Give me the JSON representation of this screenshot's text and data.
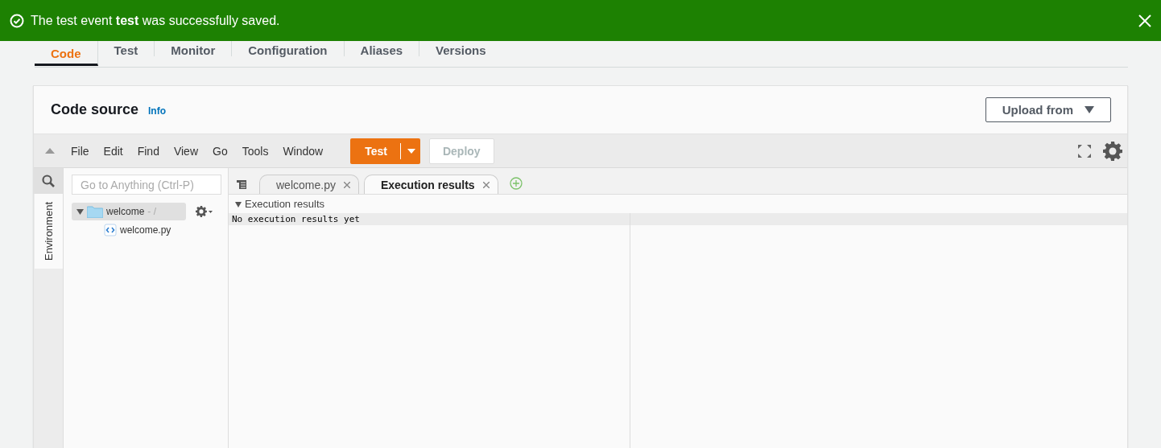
{
  "banner": {
    "kind": "success",
    "message": "The test event **test** was successfully saved."
  },
  "tabs": [
    {
      "label": "Code",
      "selected": true
    },
    {
      "label": "Test",
      "selected": false
    },
    {
      "label": "Monitor",
      "selected": false
    },
    {
      "label": "Configuration",
      "selected": false
    },
    {
      "label": "Aliases",
      "selected": false
    },
    {
      "label": "Versions",
      "selected": false
    }
  ],
  "code_source": {
    "title": "Code source",
    "info_link": "Info",
    "upload_button": "Upload from"
  },
  "toolbar": {
    "menu": [
      "File",
      "Edit",
      "Find",
      "View",
      "Go",
      "Tools",
      "Window"
    ],
    "test_button": "Test",
    "deploy_button": {
      "label": "Deploy",
      "disabled": true
    }
  },
  "sidebar": {
    "environment_tab": "Environment",
    "search": {
      "placeholder": "Go to Anything (Ctrl-P)"
    }
  },
  "tree": [
    {
      "name": "welcome",
      "path": "- /",
      "kind": "folder",
      "selected": true,
      "expanded": true,
      "children": [
        {
          "name": "welcome.py",
          "kind": "file",
          "selected": false
        }
      ]
    }
  ],
  "editor_tabs": [
    {
      "label": "welcome.py",
      "selected": false
    },
    {
      "label": "Execution results",
      "selected": true
    }
  ],
  "results": {
    "header": "Execution results",
    "expanded": true,
    "output": "No execution results yet"
  }
}
